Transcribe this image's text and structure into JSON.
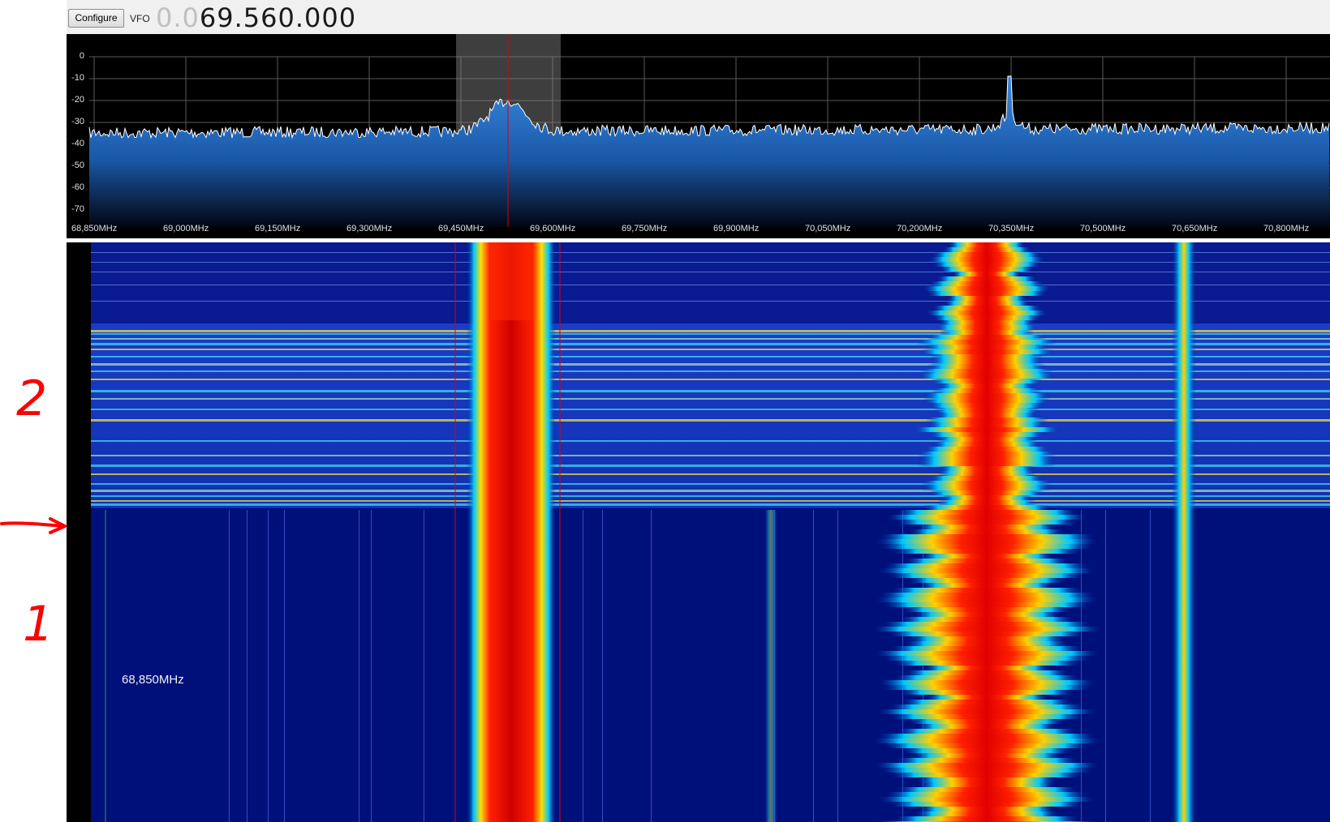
{
  "toolbar": {
    "configure_label": "Configure",
    "vfo_label": "VFO",
    "vfo_dim": "0.0",
    "vfo_main": "69.560.000"
  },
  "spectrum": {
    "db_labels": [
      "0",
      "-10",
      "-20",
      "-30",
      "-40",
      "-50",
      "-60",
      "-70"
    ],
    "freq_labels": [
      "68,850MHz",
      "69,000MHz",
      "69,150MHz",
      "69,300MHz",
      "69,450MHz",
      "69,600MHz",
      "69,750MHz",
      "69,900MHz",
      "70,050MHz",
      "70,200MHz",
      "70,350MHz",
      "70,500MHz",
      "70,650MHz",
      "70,800MHz"
    ],
    "trace_color": "#ffffff",
    "fill_color": "#1e6fc0",
    "filter_band_color": "#8a8a8a",
    "tuning_line_color": "#e00000"
  },
  "waterfall": {
    "cursor_freq_label": "68,850MHz",
    "background_color": "#00107a",
    "signal_colors": [
      "#ff1a00",
      "#ffdd00",
      "#00e0ff"
    ]
  },
  "annotations": {
    "label_2": "2",
    "label_1": "1",
    "color": "#ff0000"
  }
}
